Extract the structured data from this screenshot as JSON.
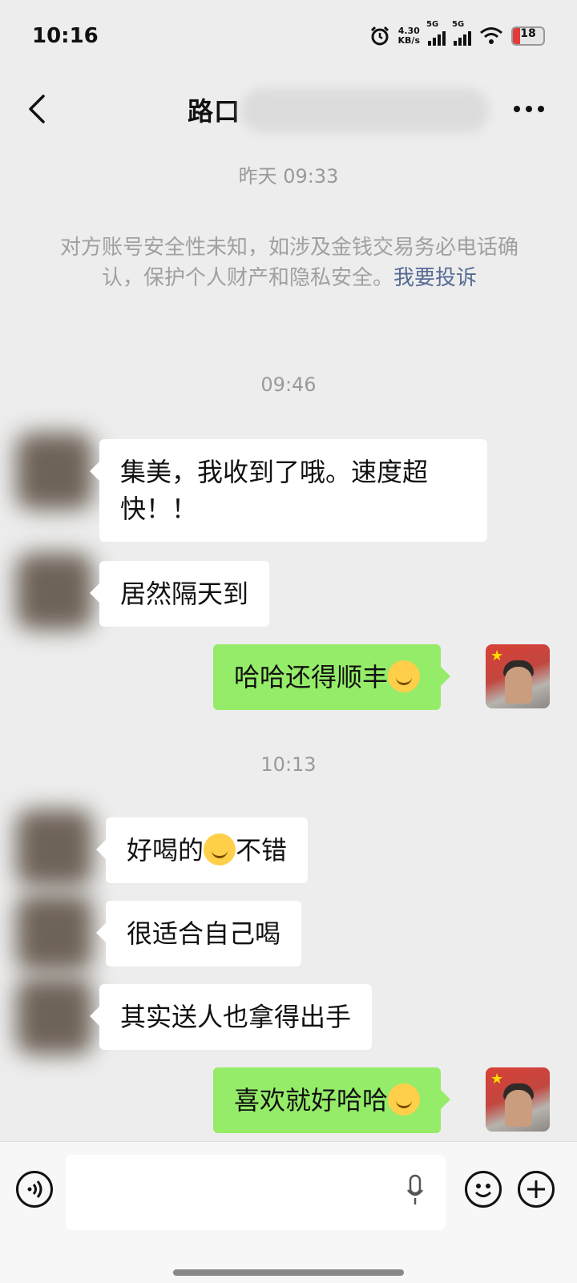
{
  "status": {
    "time": "10:16",
    "net_speed_value": "4.30",
    "net_speed_unit": "KB/s",
    "signal1_label": "5G",
    "signal2_label": "5G",
    "battery": "18"
  },
  "chat": {
    "header": {
      "title": "路口",
      "back_icon": "chevron-left-icon",
      "more_icon": "more-horizontal-icon"
    },
    "timestamps": [
      "昨天 09:33",
      "09:46",
      "10:13"
    ],
    "notice": {
      "text": "对方账号安全性未知，如涉及金钱交易务必电话确认，保护个人财产和隐私安全。",
      "link": "我要投诉"
    },
    "messages": [
      {
        "side": "in",
        "text": "集美，我收到了哦。速度超快！！"
      },
      {
        "side": "in",
        "text": "居然隔天到"
      },
      {
        "side": "out",
        "text": "哈哈还得顺丰",
        "emoji": "hands-over-mouth-icon"
      },
      {
        "side": "in",
        "text": "好喝的",
        "emoji": "thinking-face-icon",
        "text_after": "不错"
      },
      {
        "side": "in",
        "text": "很适合自己喝"
      },
      {
        "side": "in",
        "text": "其实送人也拿得出手"
      },
      {
        "side": "out",
        "text": "喜欢就好哈哈",
        "emoji": "grinning-face-icon"
      }
    ]
  },
  "input_bar": {
    "voice_icon": "voice-icon",
    "mic_icon": "mic-icon",
    "emoji_icon": "emoji-icon",
    "plus_icon": "plus-icon",
    "input_value": ""
  },
  "colors": {
    "background": "#ededed",
    "incoming_bubble": "#ffffff",
    "outgoing_bubble": "#95ec69",
    "link": "#576b95"
  }
}
